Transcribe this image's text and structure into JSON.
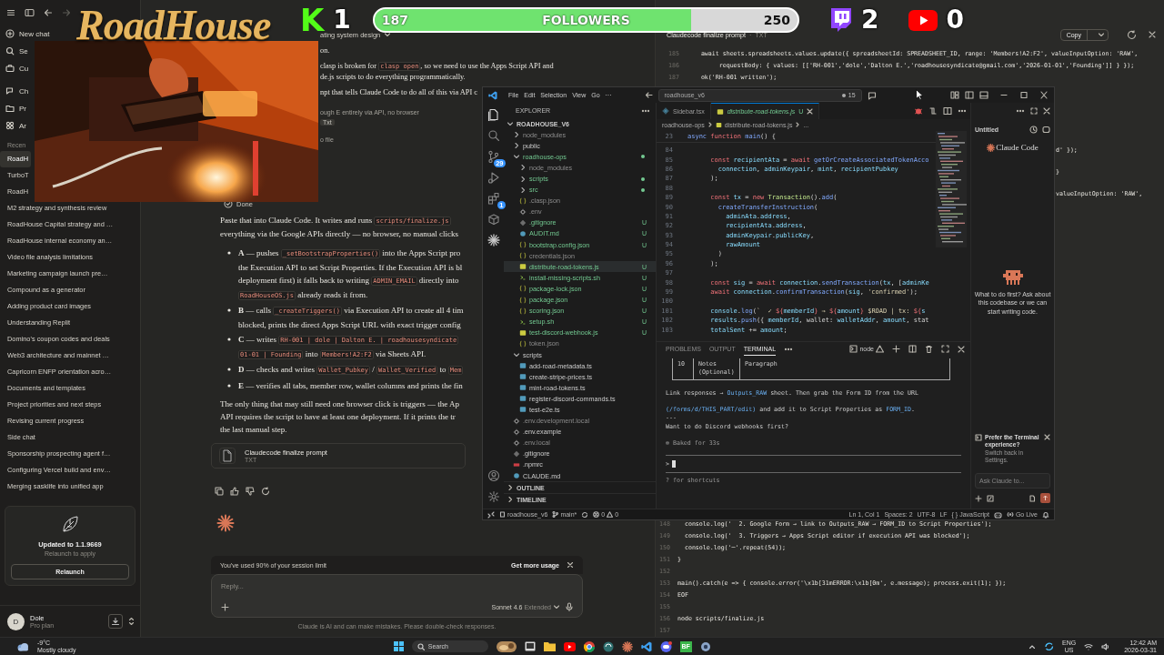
{
  "overlay": {
    "logo": "RoadHouse",
    "kick_logo": "K",
    "kick_count": "1",
    "followers": {
      "current": "187",
      "label": "FOLLOWERS",
      "goal": "250",
      "level": 0.748
    },
    "twitch_count": "2",
    "youtube_count": "0"
  },
  "sidebar": {
    "nav": [
      "New chat",
      "Se",
      "Cu"
    ],
    "nav2": [
      "Ch",
      "Pr",
      "Ar"
    ],
    "recents_label": "Recen",
    "recents": [
      {
        "label": "RoadH",
        "selected": true
      },
      {
        "label": "TurboT",
        "selected": false
      },
      {
        "label": "RoadH",
        "selected": false
      },
      {
        "label": "M2 strategy and synthesis review",
        "selected": false
      },
      {
        "label": "RoadHouse Capital strategy and …",
        "selected": false
      },
      {
        "label": "RoadHouse internal economy an…",
        "selected": false
      },
      {
        "label": "Video file analysis limitations",
        "selected": false
      },
      {
        "label": "Marketing campaign launch pre…",
        "selected": false
      },
      {
        "label": "Compound as a generator",
        "selected": false
      },
      {
        "label": "Adding product card images",
        "selected": false
      },
      {
        "label": "Understanding Replit",
        "selected": false
      },
      {
        "label": "Domino's coupon codes and deals",
        "selected": false
      },
      {
        "label": "Web3 architecture and mainnet …",
        "selected": false
      },
      {
        "label": "Capricorn ENFP orientation acro…",
        "selected": false
      },
      {
        "label": "Documents and templates",
        "selected": false
      },
      {
        "label": "Project priorities and next steps",
        "selected": false
      },
      {
        "label": "Revising current progress",
        "selected": false
      },
      {
        "label": "Side chat",
        "selected": false
      },
      {
        "label": "Sponsorship prospecting agent f…",
        "selected": false
      },
      {
        "label": "Configuring Vercel build and env…",
        "selected": false
      },
      {
        "label": "Merging sasklife into unified app",
        "selected": false
      }
    ],
    "update": {
      "title": "Updated to 1.1.9669",
      "subtitle": "Relaunch to apply",
      "button": "Relaunch"
    },
    "user": {
      "initial": "D",
      "name": "Dole",
      "plan": "Pro plan"
    }
  },
  "chat": {
    "title": "ating system design",
    "top_paragraphs": [
      [
        [
          "on."
        ]
      ],
      [
        [
          "clasp is broken for ",
          {
            "code": "clasp open"
          },
          ", so we need to use the Apps Script API and"
        ],
        [
          "de.js scripts to do everything programmatically."
        ]
      ],
      [
        [
          "npt that tells Claude Code to do all of this via API c"
        ]
      ]
    ],
    "tool_steps": [
      "ough E entirely via API, no browser",
      "o file"
    ],
    "tool_tag": "Txt",
    "status": "Done",
    "blocks": [
      {
        "kind": "paragraph",
        "lines": [
          [
            "Paste that into Claude Code. It writes and runs ",
            {
              "code": "scripts/finalize.js"
            }
          ],
          [
            "everything via the Google APIs directly — no browser, no manual clicks"
          ]
        ]
      },
      {
        "kind": "bullets",
        "items": [
          {
            "lines": [
              [
                "**A** — pushes ",
                {
                  "code": "_setBootstrapProperties()"
                },
                " into the Apps Script pro"
              ],
              [
                "the Execution API to set Script Properties. If the Execution API is bl"
              ],
              [
                "deployment first) it falls back to writing ",
                {
                  "code": "ADMIN_EMAIL"
                },
                " directly into"
              ],
              [
                {
                  "code": "RoadHouseOS.js"
                },
                " already reads it from."
              ]
            ]
          },
          {
            "lines": [
              [
                "**B** — calls ",
                {
                  "code": "_createTriggers()"
                },
                " via Execution API to create all 4 tim"
              ],
              [
                "blocked, prints the direct Apps Script URL with exact trigger config"
              ]
            ]
          },
          {
            "lines": [
              [
                "**C** — writes ",
                {
                  "code": "RH-001 | dole | Dalton E. | roadhousesyndicate"
                }
              ],
              [
                {
                  "code": "01-01 | Founding"
                },
                " into ",
                {
                  "code": "Members!A2:F2"
                },
                " via Sheets API."
              ]
            ]
          },
          {
            "lines": [
              [
                "**D** — checks and writes ",
                {
                  "code": "Wallet_Pubkey"
                },
                " / ",
                {
                  "code": "Wallet_Verified"
                },
                " to ",
                {
                  "code": "Mem"
                }
              ]
            ]
          },
          {
            "lines": [
              [
                "**E** — verifies all tabs, member row, wallet columns and prints the fin"
              ]
            ]
          }
        ]
      },
      {
        "kind": "paragraph",
        "lines": [
          [
            "The only thing that may still need one browser click is triggers — the Ap"
          ],
          [
            "API requires the script to have at least one deployment. If it prints the tr"
          ],
          [
            "the last manual step."
          ]
        ]
      },
      {
        "kind": "file",
        "title": "Claudecode finalize prompt",
        "type": "TXT"
      }
    ],
    "usage": {
      "text": "You've used 90% of your session limit",
      "link": "Get more usage"
    },
    "reply_placeholder": "Reply...",
    "model": "Sonnet 4.6",
    "mode": "Extended",
    "disclaimer": "Claude is AI and can make mistakes. Please double-check responses."
  },
  "artifact": {
    "title": "Claudecode finalize prompt",
    "separator": "·",
    "type": "TXT",
    "copy": "Copy",
    "top_lines": [
      {
        "n": "185",
        "t": "    await sheets.spreadsheets.values.update({ spreadsheetId: SPREADSHEET_ID, range: 'Members!A2:F2', valueInputOption: 'RAW',"
      },
      {
        "n": "186",
        "t": "         requestBody: { values: [['RH-001','dole','Dalton E.','roadhousesyndicate@gmail.com','2026-01-01','Founding']] } });"
      },
      {
        "n": "187",
        "t": "    ok('RH-001 written');"
      }
    ],
    "fragments": [
      "d' });",
      "}",
      "valueInputOption: 'RAW',"
    ],
    "bottom_lines": [
      {
        "n": "148",
        "t": "  console.log('  2. Google Form → link to Outputs_RAW → FORM_ID to Script Properties');"
      },
      {
        "n": "149",
        "t": "  console.log('  3. Triggers → Apps Script editor if execution API was blocked');"
      },
      {
        "n": "150",
        "t": "  console.log('─'.repeat(54));"
      },
      {
        "n": "151",
        "t": "}"
      },
      {
        "n": "152"
      },
      {
        "n": "153",
        "t": "main().catch(e => { console.error('\\x1b[31mERROR:\\x1b[0m', e.message); process.exit(1); });"
      },
      {
        "n": "154",
        "t": "EOF"
      },
      {
        "n": "155"
      },
      {
        "n": "156",
        "t": "node scripts/finalize.js"
      },
      {
        "n": "157"
      }
    ]
  },
  "vscode": {
    "menu": [
      "File",
      "Edit",
      "Selection",
      "View",
      "Go",
      "···"
    ],
    "search": "roadhouse_v6",
    "notifications": "15",
    "activity_badges": [
      "29",
      "1"
    ],
    "explorer": {
      "title": "EXPLORER",
      "tree": [
        {
          "name": "ROADHOUSE_V6",
          "kind": "folder",
          "expanded": true,
          "untracked": false,
          "ignored": false,
          "selected": false,
          "dot": false,
          "children": [
            {
              "name": "node_modules",
              "kind": "folder",
              "expanded": false,
              "untracked": false,
              "ignored": true,
              "selected": false,
              "dot": false
            },
            {
              "name": "public",
              "kind": "folder",
              "expanded": false,
              "untracked": false,
              "ignored": false,
              "selected": false,
              "dot": false
            },
            {
              "name": "roadhouse-ops",
              "kind": "folder",
              "expanded": true,
              "untracked": true,
              "ignored": false,
              "selected": false,
              "dot": true,
              "children": [
                {
                  "name": "node_modules",
                  "kind": "folder",
                  "expanded": false,
                  "untracked": false,
                  "ignored": true,
                  "selected": false,
                  "dot": false
                },
                {
                  "name": "scripts",
                  "kind": "folder",
                  "expanded": false,
                  "untracked": true,
                  "ignored": false,
                  "selected": false,
                  "dot": true
                },
                {
                  "name": "src",
                  "kind": "folder",
                  "expanded": false,
                  "untracked": true,
                  "ignored": false,
                  "selected": false,
                  "dot": true
                },
                {
                  "name": ".clasp.json",
                  "kind": "json",
                  "untracked": false,
                  "ignored": true,
                  "selected": false,
                  "dot": false
                },
                {
                  "name": ".env",
                  "kind": "env",
                  "untracked": false,
                  "ignored": true,
                  "selected": false,
                  "dot": false
                },
                {
                  "name": ".gitignore",
                  "kind": "git",
                  "untracked": true,
                  "ignored": false,
                  "selected": false,
                  "dot": false,
                  "badge": "U"
                },
                {
                  "name": "AUDIT.md",
                  "kind": "md",
                  "untracked": true,
                  "ignored": false,
                  "selected": false,
                  "dot": false,
                  "badge": "U"
                },
                {
                  "name": "bootstrap.config.json",
                  "kind": "json",
                  "untracked": true,
                  "ignored": false,
                  "selected": false,
                  "dot": false,
                  "badge": "U"
                },
                {
                  "name": "credentials.json",
                  "kind": "json",
                  "untracked": false,
                  "ignored": true,
                  "selected": false,
                  "dot": false
                },
                {
                  "name": "distribute-road-tokens.js",
                  "kind": "js",
                  "untracked": true,
                  "ignored": false,
                  "selected": true,
                  "dot": false,
                  "badge": "U"
                },
                {
                  "name": "install-missing-scripts.sh",
                  "kind": "sh",
                  "untracked": true,
                  "ignored": false,
                  "selected": false,
                  "dot": false,
                  "badge": "U"
                },
                {
                  "name": "package-lock.json",
                  "kind": "json",
                  "untracked": true,
                  "ignored": false,
                  "selected": false,
                  "dot": false,
                  "badge": "U"
                },
                {
                  "name": "package.json",
                  "kind": "json",
                  "untracked": true,
                  "ignored": false,
                  "selected": false,
                  "dot": false,
                  "badge": "U"
                },
                {
                  "name": "scoring.json",
                  "kind": "json",
                  "untracked": true,
                  "ignored": false,
                  "selected": false,
                  "dot": false,
                  "badge": "U"
                },
                {
                  "name": "setup.sh",
                  "kind": "sh",
                  "untracked": true,
                  "ignored": false,
                  "selected": false,
                  "dot": false,
                  "badge": "U"
                },
                {
                  "name": "test-discord-webhook.js",
                  "kind": "js",
                  "untracked": true,
                  "ignored": false,
                  "selected": false,
                  "dot": false,
                  "badge": "U"
                },
                {
                  "name": "token.json",
                  "kind": "json",
                  "untracked": false,
                  "ignored": true,
                  "selected": false,
                  "dot": false
                }
              ]
            },
            {
              "name": "scripts",
              "kind": "folder",
              "expanded": true,
              "untracked": false,
              "ignored": false,
              "selected": false,
              "dot": false,
              "children": [
                {
                  "name": "add-road-metadata.ts",
                  "kind": "ts",
                  "untracked": false,
                  "ignored": false,
                  "selected": false,
                  "dot": false
                },
                {
                  "name": "create-stripe-prices.ts",
                  "kind": "ts",
                  "untracked": false,
                  "ignored": false,
                  "selected": false,
                  "dot": false
                },
                {
                  "name": "mint-road-tokens.ts",
                  "kind": "ts",
                  "untracked": false,
                  "ignored": false,
                  "selected": false,
                  "dot": false
                },
                {
                  "name": "register-discord-commands.ts",
                  "kind": "ts",
                  "untracked": false,
                  "ignored": false,
                  "selected": false,
                  "dot": false
                },
                {
                  "name": "test-e2e.ts",
                  "kind": "ts",
                  "untracked": false,
                  "ignored": false,
                  "selected": false,
                  "dot": false
                }
              ]
            },
            {
              "name": ".env.development.local",
              "kind": "env",
              "untracked": false,
              "ignored": true,
              "selected": false,
              "dot": false
            },
            {
              "name": ".env.example",
              "kind": "env",
              "untracked": false,
              "ignored": false,
              "selected": false,
              "dot": false
            },
            {
              "name": ".env.local",
              "kind": "env",
              "untracked": false,
              "ignored": true,
              "selected": false,
              "dot": false
            },
            {
              "name": ".gitignore",
              "kind": "git",
              "untracked": false,
              "ignored": false,
              "selected": false,
              "dot": false
            },
            {
              "name": ".npmrc",
              "kind": "npm",
              "untracked": false,
              "ignored": false,
              "selected": false,
              "dot": false
            },
            {
              "name": "CLAUDE.md",
              "kind": "md",
              "untracked": false,
              "ignored": false,
              "selected": false,
              "dot": false
            }
          ]
        }
      ],
      "sections": [
        {
          "label": "OUTLINE",
          "expanded": false
        },
        {
          "label": "TIMELINE",
          "expanded": false
        }
      ]
    },
    "tabs": [
      {
        "label": "Sidebar.tsx",
        "kind": "tsx",
        "selected": false
      },
      {
        "label": "distribute-road-tokens.js",
        "kind": "js",
        "badge": "U",
        "selected": true
      }
    ],
    "breadcrumb": [
      "roadhouse-ops",
      "distribute-road-tokens.js",
      "..."
    ],
    "sticky": {
      "n": "23",
      "t": [
        {
          "kind": "storage",
          "text": "async "
        },
        {
          "kind": "keyword",
          "text": "function "
        },
        {
          "kind": "function",
          "text": "main"
        },
        {
          "kind": "plain",
          "text": "() {"
        }
      ]
    },
    "code": [
      {
        "n": "84"
      },
      {
        "n": "85",
        "t": [
          {
            "kind": "keyword",
            "text": "      const "
          },
          {
            "kind": "variable",
            "text": "recipientAta"
          },
          {
            "kind": "plain",
            "text": " = "
          },
          {
            "kind": "keyword",
            "text": "await "
          },
          {
            "kind": "function",
            "text": "getOrCreateAssociatedTokenAcco"
          }
        ]
      },
      {
        "n": "86",
        "t": [
          {
            "kind": "variable",
            "text": "        connection"
          },
          {
            "kind": "plain",
            "text": ", "
          },
          {
            "kind": "variable",
            "text": "adminKeypair"
          },
          {
            "kind": "plain",
            "text": ", "
          },
          {
            "kind": "variable",
            "text": "mint"
          },
          {
            "kind": "plain",
            "text": ", "
          },
          {
            "kind": "variable",
            "text": "recipientPubkey"
          }
        ]
      },
      {
        "n": "87",
        "t": [
          {
            "kind": "plain",
            "text": "      );"
          }
        ]
      },
      {
        "n": "88"
      },
      {
        "n": "89",
        "t": [
          {
            "kind": "keyword",
            "text": "      const "
          },
          {
            "kind": "variable",
            "text": "tx"
          },
          {
            "kind": "plain",
            "text": " = "
          },
          {
            "kind": "keyword",
            "text": "new "
          },
          {
            "kind": "class",
            "text": "Transaction"
          },
          {
            "kind": "plain",
            "text": "()."
          },
          {
            "kind": "function",
            "text": "add"
          },
          {
            "kind": "plain",
            "text": "("
          }
        ]
      },
      {
        "n": "90",
        "t": [
          {
            "kind": "function",
            "text": "        createTransferInstruction"
          },
          {
            "kind": "plain",
            "text": "("
          }
        ]
      },
      {
        "n": "91",
        "t": [
          {
            "kind": "variable",
            "text": "          adminAta"
          },
          {
            "kind": "plain",
            "text": "."
          },
          {
            "kind": "variable",
            "text": "address"
          },
          {
            "kind": "plain",
            "text": ","
          }
        ]
      },
      {
        "n": "92",
        "t": [
          {
            "kind": "variable",
            "text": "          recipientAta"
          },
          {
            "kind": "plain",
            "text": "."
          },
          {
            "kind": "variable",
            "text": "address"
          },
          {
            "kind": "plain",
            "text": ","
          }
        ]
      },
      {
        "n": "93",
        "t": [
          {
            "kind": "variable",
            "text": "          adminKeypair"
          },
          {
            "kind": "plain",
            "text": "."
          },
          {
            "kind": "variable",
            "text": "publicKey"
          },
          {
            "kind": "plain",
            "text": ","
          }
        ]
      },
      {
        "n": "94",
        "t": [
          {
            "kind": "variable",
            "text": "          rawAmount"
          }
        ]
      },
      {
        "n": "95",
        "t": [
          {
            "kind": "plain",
            "text": "        )"
          }
        ]
      },
      {
        "n": "96",
        "t": [
          {
            "kind": "plain",
            "text": "      );"
          }
        ]
      },
      {
        "n": "97"
      },
      {
        "n": "98",
        "t": [
          {
            "kind": "keyword",
            "text": "      const "
          },
          {
            "kind": "variable",
            "text": "sig"
          },
          {
            "kind": "plain",
            "text": " = "
          },
          {
            "kind": "keyword",
            "text": "await "
          },
          {
            "kind": "variable",
            "text": "connection"
          },
          {
            "kind": "plain",
            "text": "."
          },
          {
            "kind": "function",
            "text": "sendTransaction"
          },
          {
            "kind": "plain",
            "text": "("
          },
          {
            "kind": "variable",
            "text": "tx"
          },
          {
            "kind": "plain",
            "text": ", ["
          },
          {
            "kind": "variable",
            "text": "adminKe"
          }
        ]
      },
      {
        "n": "99",
        "t": [
          {
            "kind": "keyword",
            "text": "      await "
          },
          {
            "kind": "variable",
            "text": "connection"
          },
          {
            "kind": "plain",
            "text": "."
          },
          {
            "kind": "function",
            "text": "confirmTransaction"
          },
          {
            "kind": "plain",
            "text": "("
          },
          {
            "kind": "variable",
            "text": "sig"
          },
          {
            "kind": "plain",
            "text": ", "
          },
          {
            "kind": "string",
            "text": "'confirmed'"
          },
          {
            "kind": "plain",
            "text": ");"
          }
        ]
      },
      {
        "n": "100"
      },
      {
        "n": "101",
        "t": [
          {
            "kind": "variable",
            "text": "      console"
          },
          {
            "kind": "plain",
            "text": "."
          },
          {
            "kind": "function",
            "text": "log"
          },
          {
            "kind": "plain",
            "text": "("
          },
          {
            "kind": "string",
            "text": "`  ✓ "
          },
          {
            "kind": "keyword",
            "text": "${"
          },
          {
            "kind": "variable",
            "text": "memberId"
          },
          {
            "kind": "keyword",
            "text": "}"
          },
          {
            "kind": "string",
            "text": " → "
          },
          {
            "kind": "keyword",
            "text": "${"
          },
          {
            "kind": "variable",
            "text": "amount"
          },
          {
            "kind": "keyword",
            "text": "}"
          },
          {
            "kind": "string",
            "text": " $ROAD | tx: "
          },
          {
            "kind": "keyword",
            "text": "${"
          },
          {
            "kind": "variable",
            "text": "s"
          }
        ]
      },
      {
        "n": "102",
        "t": [
          {
            "kind": "variable",
            "text": "      results"
          },
          {
            "kind": "plain",
            "text": "."
          },
          {
            "kind": "function",
            "text": "push"
          },
          {
            "kind": "plain",
            "text": "({ "
          },
          {
            "kind": "variable",
            "text": "memberId"
          },
          {
            "kind": "plain",
            "text": ", wallet: "
          },
          {
            "kind": "variable",
            "text": "walletAddr"
          },
          {
            "kind": "plain",
            "text": ", "
          },
          {
            "kind": "variable",
            "text": "amount"
          },
          {
            "kind": "plain",
            "text": ", stat"
          }
        ]
      },
      {
        "n": "103",
        "t": [
          {
            "kind": "variable",
            "text": "      totalSent"
          },
          {
            "kind": "plain",
            "text": " += "
          },
          {
            "kind": "variable",
            "text": "amount"
          },
          {
            "kind": "plain",
            "text": ";"
          }
        ]
      }
    ],
    "panel": {
      "tabs": [
        {
          "label": "PROBLEMS",
          "selected": false
        },
        {
          "label": "OUTPUT",
          "selected": false
        },
        {
          "label": "TERMINAL",
          "selected": true
        }
      ],
      "terminal": "node",
      "table_row": [
        "10",
        "Notes (Optional)",
        "Paragraph"
      ],
      "lines": [
        [
          "Link responses → ",
          {
            "code": "Outputs_RAW"
          },
          " sheet. Then grab the Form ID from the URL"
        ],
        [
          {
            "code": "(/forms/d/THIS_PART/edit)"
          },
          " and add it to Script Properties as ",
          {
            "code": "FORM_ID"
          },
          "."
        ],
        [
          "---"
        ],
        [
          "Want to do Discord webhooks first?"
        ]
      ],
      "baked": "✻ Baked for 33s",
      "prompt": ">",
      "hint": "? for shortcuts"
    },
    "claude_panel": {
      "title": "Untitled",
      "logo": "Claude Code",
      "message": "What to do first? Ask about this codebase or we can start writing code.",
      "tip_title": "Prefer the Terminal experience?",
      "tip_body": "Switch back in Settings.",
      "input_placeholder": "Ask Claude to..."
    },
    "status_bar": {
      "folder": "roadhouse_v6",
      "branch": "main*",
      "errors": "0",
      "warnings": "0",
      "position": "Ln 1, Col 1",
      "spaces": "Spaces: 2",
      "encoding": "UTF-8",
      "eol": "LF",
      "language_icon": "{ }",
      "language": "JavaScript",
      "go_live": "Go Live"
    }
  },
  "taskbar": {
    "temp": "-9°C",
    "weather": "Mostly cloudy",
    "search": "Search",
    "app_label": "BF",
    "lang": "ENG",
    "region": "US",
    "time": "12:42 AM",
    "date": "2026-03-31"
  }
}
